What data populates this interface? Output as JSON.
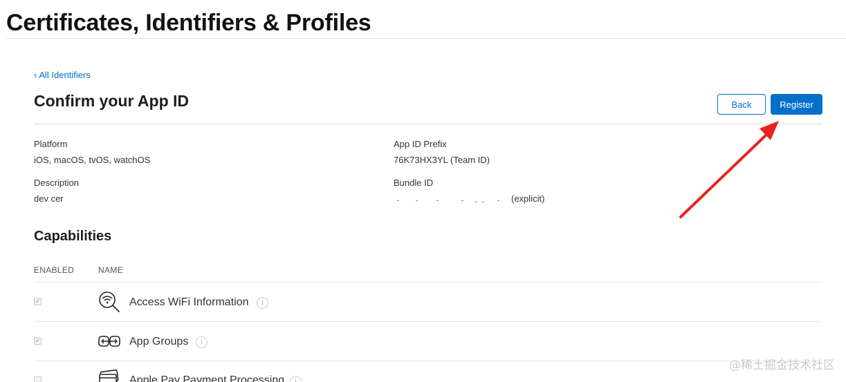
{
  "page": {
    "title": "Certificates, Identifiers & Profiles"
  },
  "nav": {
    "back_link": "All Identifiers",
    "back_chevron": "‹"
  },
  "section": {
    "title": "Confirm your App ID",
    "back_button": "Back",
    "register_button": "Register"
  },
  "details": {
    "platform_label": "Platform",
    "platform_value": "iOS, macOS, tvOS, watchOS",
    "prefix_label": "App ID Prefix",
    "prefix_value": "76K73HX3YL (Team ID)",
    "description_label": "Description",
    "description_value": "dev cer",
    "bundle_label": "Bundle ID",
    "bundle_suffix": "(explicit)"
  },
  "capabilities": {
    "title": "Capabilities",
    "col_enabled": "ENABLED",
    "col_name": "NAME",
    "rows": [
      {
        "name": "Access WiFi Information",
        "enabled": true,
        "icon": "wifi-search-icon"
      },
      {
        "name": "App Groups",
        "enabled": true,
        "icon": "app-groups-icon"
      },
      {
        "name": "Apple Pay Payment Processing",
        "enabled": false,
        "icon": "apple-pay-icon"
      }
    ]
  },
  "watermark": "@稀土掘金技术社区",
  "colors": {
    "accent": "#0070c9",
    "annotation_arrow": "#e8231f"
  }
}
